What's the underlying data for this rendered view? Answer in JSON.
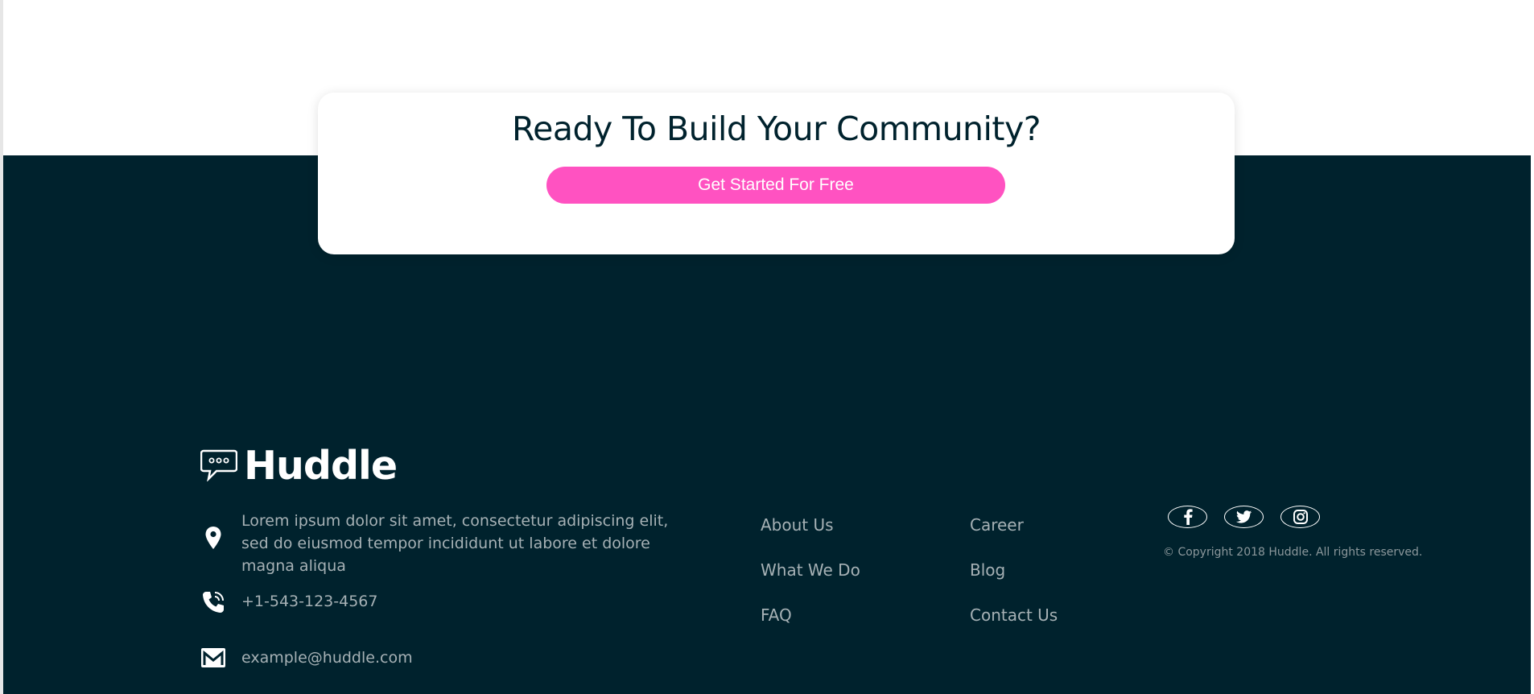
{
  "cta": {
    "title": "Ready To Build Your Community?",
    "button_label": "Get Started For Free"
  },
  "brand": {
    "name": "Huddle",
    "icon": "chat-bubble-icon"
  },
  "contact": {
    "address": "Lorem ipsum dolor sit amet, consectetur adipiscing elit, sed do eiusmod tempor incididunt ut labore et dolore magna aliqua",
    "phone": "+1-543-123-4567",
    "email": "example@huddle.com"
  },
  "links": {
    "col1": [
      "About Us",
      "What We Do",
      "FAQ"
    ],
    "col2": [
      "Career",
      "Blog",
      "Contact Us"
    ]
  },
  "social": [
    "facebook-icon",
    "twitter-icon",
    "instagram-icon"
  ],
  "copyright": "© Copyright 2018 Huddle. All rights reserved.",
  "colors": {
    "footer_bg": "#00222d",
    "accent": "#ff52c1",
    "muted_text": "#a6b1b5"
  }
}
